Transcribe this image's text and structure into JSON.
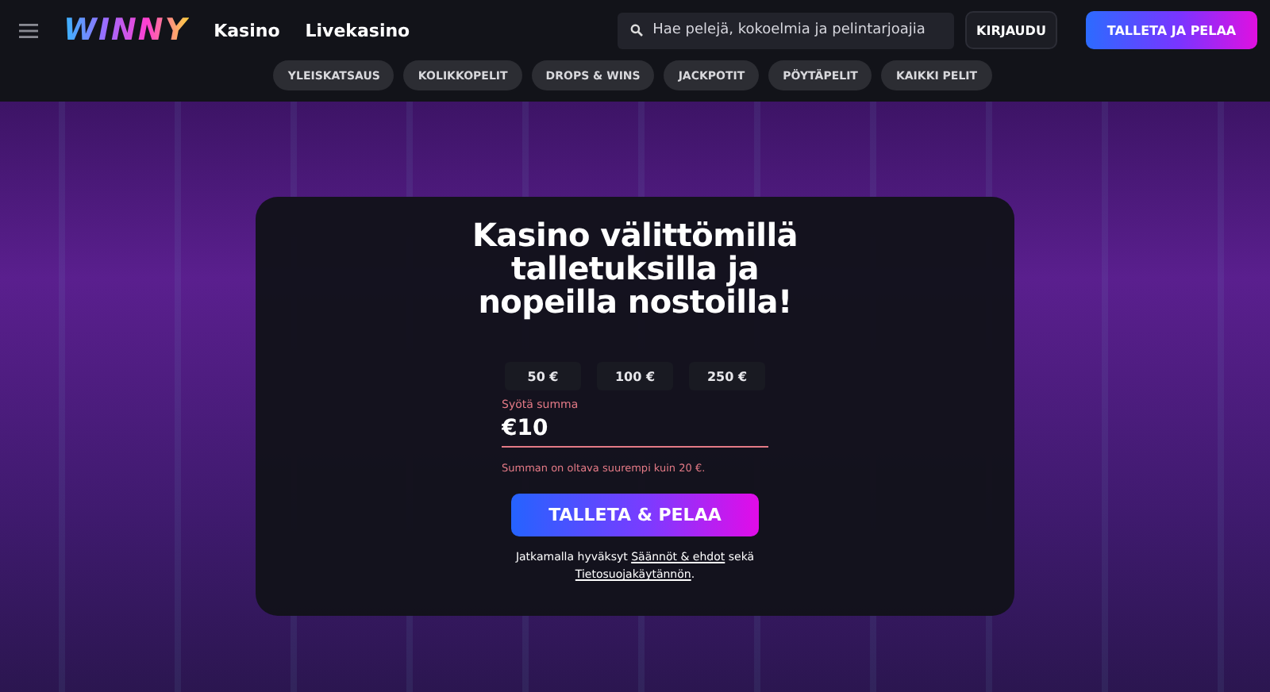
{
  "header": {
    "logo": "WINNY",
    "nav": [
      "Kasino",
      "Livekasino"
    ],
    "search": {
      "placeholder": "Hae pelejä, kokoelmia ja pelintarjoajia"
    },
    "login": "KIRJAUDU",
    "deposit": "TALLETA JA PELAA"
  },
  "categories": [
    "YLEISKATSAUS",
    "KOLIKKOPELIT",
    "DROPS & WINS",
    "JACKPOTIT",
    "PÖYTÄPELIT",
    "KAIKKI PELIT"
  ],
  "deposit_card": {
    "title": "Kasino välittömillä talletuksilla ja nopeilla nostoilla!",
    "amounts": [
      "50 €",
      "100 €",
      "250 €"
    ],
    "amount_field": {
      "label": "Syötä summa",
      "value": "€10"
    },
    "error": "Summan on oltava suurempi kuin 20 €.",
    "submit": "TALLETA & PELAA",
    "terms": [
      {
        "kind": "text",
        "text": "Jatkamalla hyväksyt "
      },
      {
        "kind": "link",
        "text": "Säännöt & ehdot"
      },
      {
        "kind": "text",
        "text": " sekä "
      },
      {
        "kind": "link",
        "text": "Tietosuojakäytännön"
      },
      {
        "kind": "text",
        "text": "."
      }
    ]
  }
}
